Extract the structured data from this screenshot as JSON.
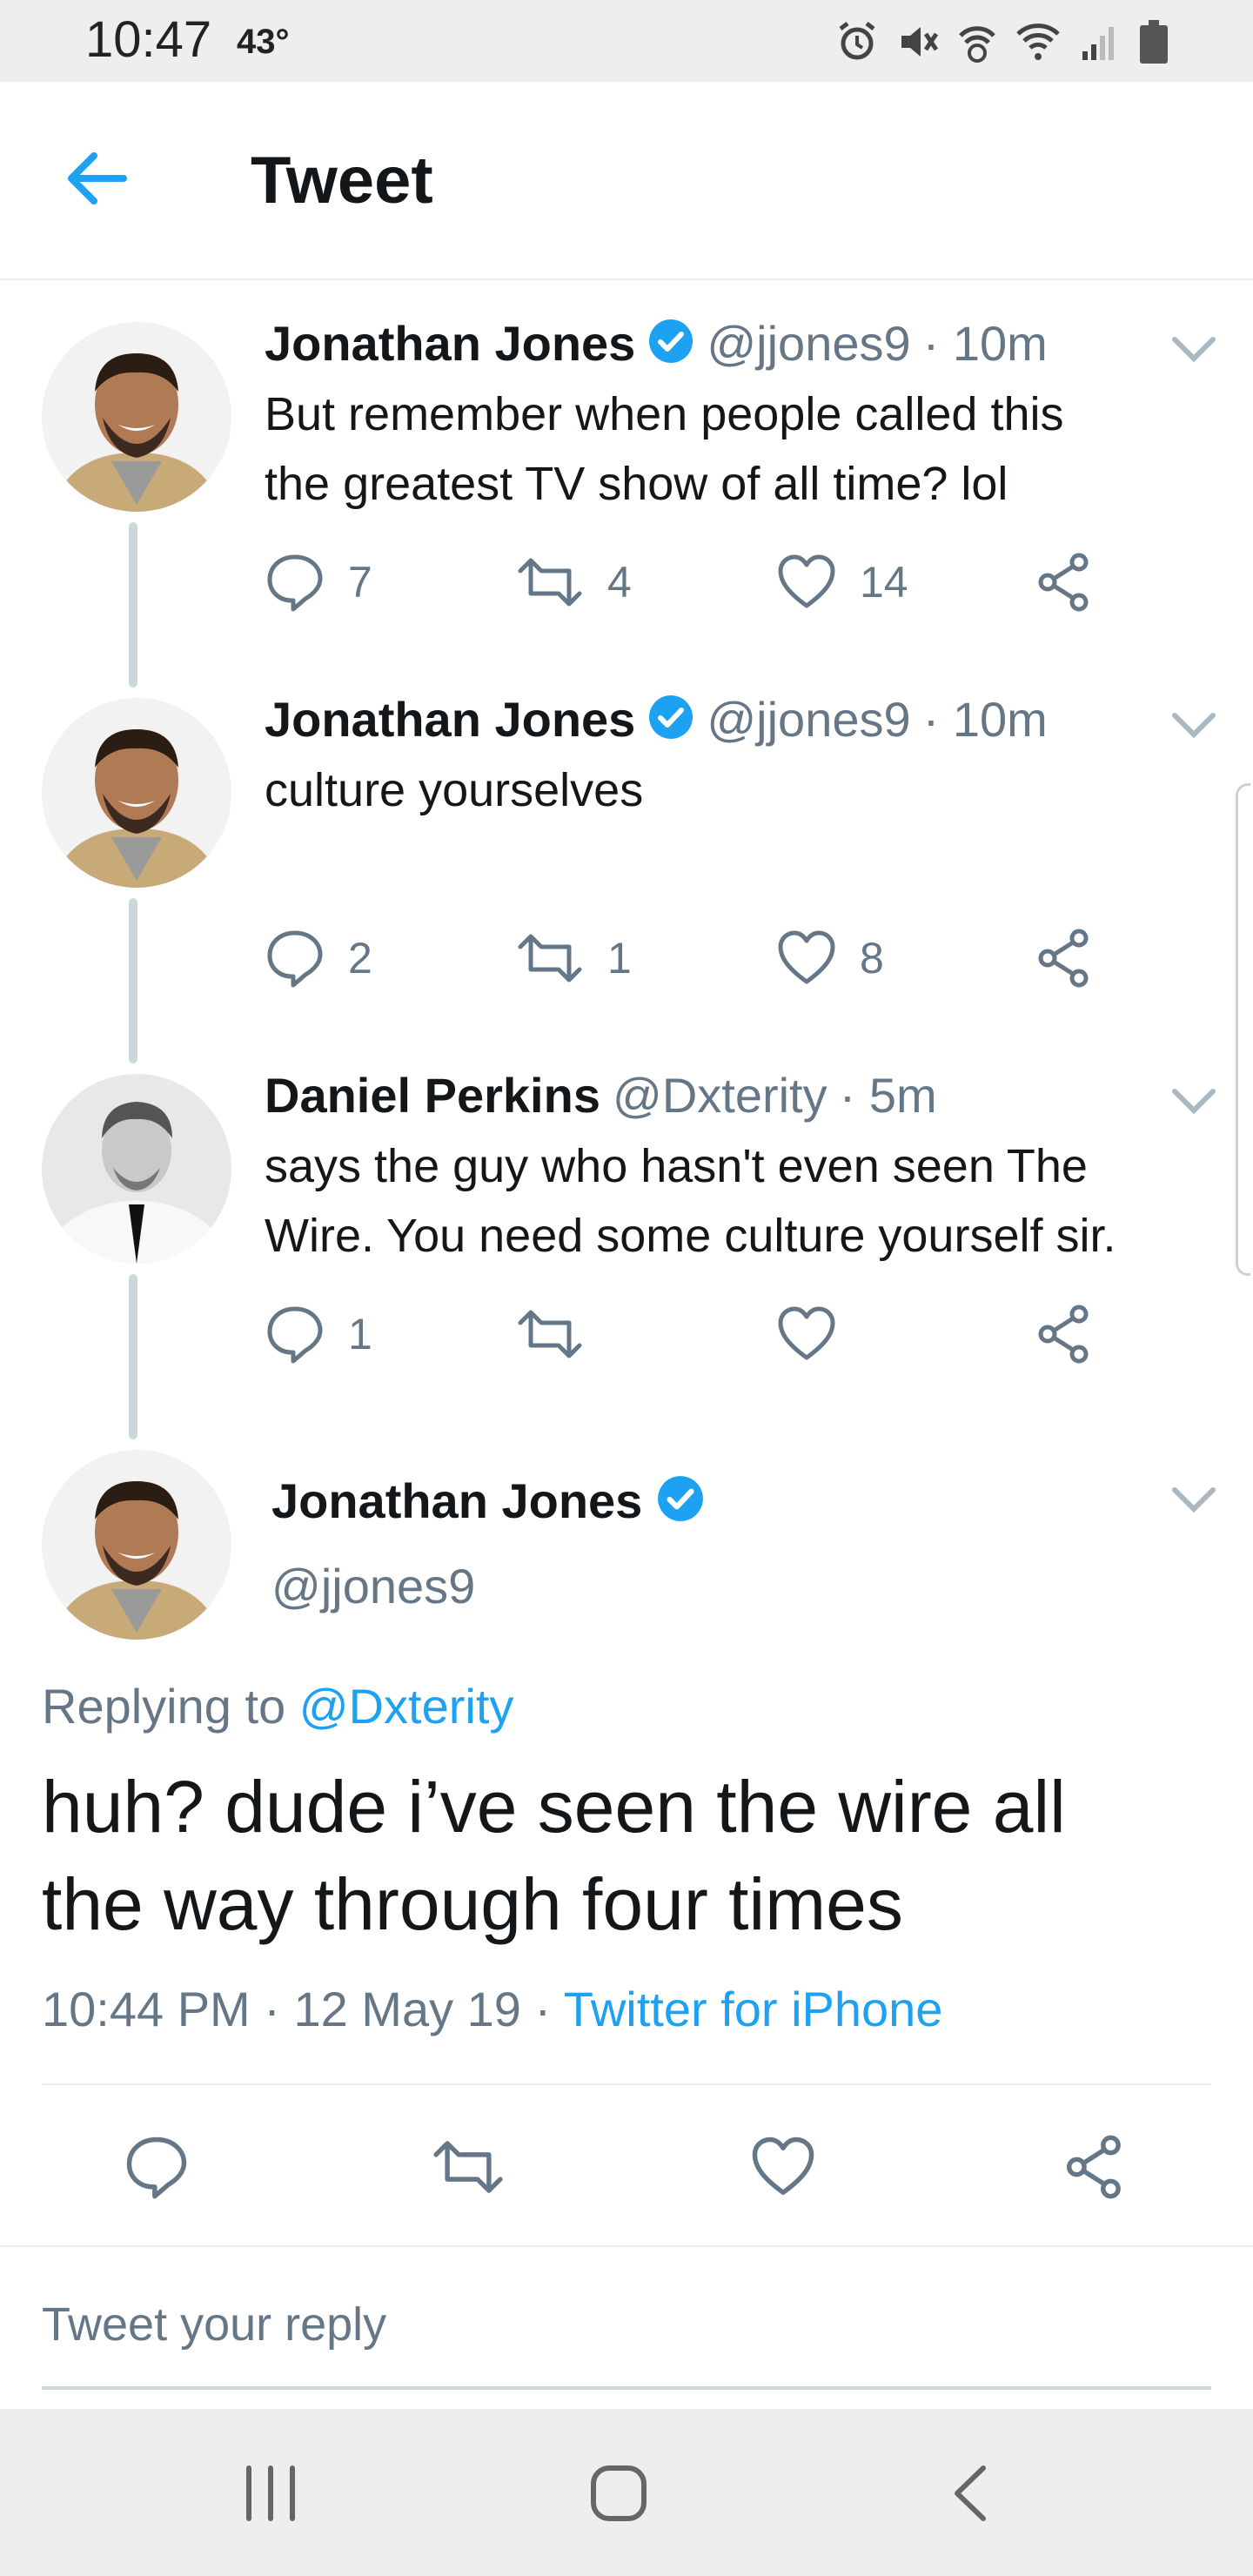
{
  "status_bar": {
    "time": "10:47",
    "temperature": "43°",
    "icons": [
      "alarm-icon",
      "mute-icon",
      "data-icon",
      "wifi-icon",
      "signal-icon",
      "battery-icon"
    ]
  },
  "header": {
    "title": "Tweet",
    "back_icon": "back-arrow-icon"
  },
  "colors": {
    "accent": "#1da1f2",
    "text": "#14171a",
    "secondary": "#657786",
    "thread_line": "#ccd6dd"
  },
  "thread": [
    {
      "name": "Jonathan Jones",
      "verified": true,
      "handle": "@jjones9",
      "time": "· 10m",
      "lines": [
        "But remember when people called this",
        "the greatest TV show of all time? lol"
      ],
      "replies": "7",
      "retweets": "4",
      "likes": "14"
    },
    {
      "name": "Jonathan Jones",
      "verified": true,
      "handle": "@jjones9",
      "time": "· 10m",
      "lines": [
        "culture yourselves"
      ],
      "replies": "2",
      "retweets": "1",
      "likes": "8"
    },
    {
      "name": "Daniel Perkins",
      "verified": false,
      "handle": "@Dxterity",
      "time": "· 5m",
      "lines": [
        "says the guy who hasn't even seen The",
        "Wire. You need some culture yourself sir."
      ],
      "replies": "1",
      "retweets": "",
      "likes": ""
    }
  ],
  "main_tweet": {
    "name": "Jonathan Jones",
    "handle": "@jjones9",
    "replying_prefix": "Replying to",
    "replying_to": "@Dxterity",
    "text_line1": "huh? dude i’ve seen the wire all",
    "text_line2": "the way through four times",
    "timestamp": "10:44 PM · 12 May 19 ·",
    "source": "Twitter for iPhone"
  },
  "reply_box": {
    "placeholder": "Tweet your reply"
  },
  "nav_bar": {
    "icons": [
      "recent-apps-icon",
      "home-icon",
      "back-icon"
    ]
  }
}
